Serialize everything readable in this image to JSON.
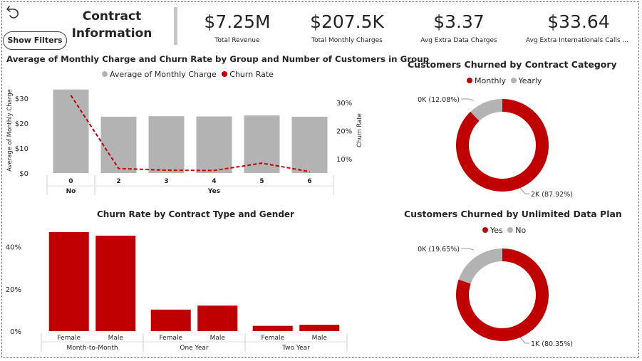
{
  "header": {
    "title_line1": "Contract",
    "title_line2": "Information",
    "show_filters_label": "Show Filters",
    "back_icon": "back-arrow-icon"
  },
  "kpis": [
    {
      "value": "$7.25M",
      "label": "Total Revenue"
    },
    {
      "value": "$207.5K",
      "label": "Total Monthly Charges"
    },
    {
      "value": "$3.37",
      "label": "Avg Extra Data Charges"
    },
    {
      "value": "$33.64",
      "label": "Avg Extra Internationals Calls ..."
    }
  ],
  "colors": {
    "red": "#c00000",
    "gray": "#b3b3b3",
    "dark": "#252423"
  },
  "chart_data": [
    {
      "type": "bar",
      "title": "Average of Monthly Charge and Churn Rate by Group and Number of Customers in Group",
      "legend": [
        "Average of Monthly Charge",
        "Churn Rate"
      ],
      "ylabel": "Average of Monthly Charge",
      "y2label": "Churn Rate",
      "categories": [
        "0",
        "2",
        "3",
        "4",
        "5",
        "6"
      ],
      "groups": [
        {
          "label": "No",
          "categories": [
            "0"
          ]
        },
        {
          "label": "Yes",
          "categories": [
            "2",
            "3",
            "4",
            "5",
            "6"
          ]
        }
      ],
      "yticks": [
        "$0",
        "$10",
        "$20",
        "$30"
      ],
      "y2ticks": [
        "10%",
        "20%",
        "30%"
      ],
      "ylim": [
        0,
        34
      ],
      "y2lim": [
        5,
        35
      ],
      "series": [
        {
          "name": "Average of Monthly Charge",
          "type": "bar",
          "values": [
            33.5,
            22.6,
            22.8,
            22.7,
            23.1,
            22.6
          ]
        },
        {
          "name": "Churn Rate",
          "type": "line",
          "values": [
            32.5,
            6.6,
            6.0,
            5.9,
            8.5,
            5.5
          ]
        }
      ]
    },
    {
      "type": "bar",
      "title": "Churn Rate by Contract Type and Gender",
      "categories": [
        "Female",
        "Male",
        "Female",
        "Male",
        "Female",
        "Male"
      ],
      "groups": [
        "Month-to-Month",
        "One Year",
        "Two Year"
      ],
      "yticks": [
        "0%",
        "20%",
        "40%"
      ],
      "ylim": [
        0,
        48
      ],
      "values": [
        47.0,
        45.3,
        10.2,
        12.1,
        2.5,
        3.0
      ]
    },
    {
      "type": "pie",
      "title": "Customers Churned by Contract Category",
      "legend": [
        "Monthly",
        "Yearly"
      ],
      "slices": [
        {
          "name": "Monthly",
          "value": 87.92,
          "label": "2K (87.92%)"
        },
        {
          "name": "Yearly",
          "value": 12.08,
          "label": "0K (12.08%)"
        }
      ]
    },
    {
      "type": "pie",
      "title": "Customers Churned by Unlimited Data Plan",
      "legend": [
        "Yes",
        "No"
      ],
      "slices": [
        {
          "name": "Yes",
          "value": 80.35,
          "label": "1K (80.35%)"
        },
        {
          "name": "No",
          "value": 19.65,
          "label": "0K (19.65%)"
        }
      ]
    }
  ]
}
